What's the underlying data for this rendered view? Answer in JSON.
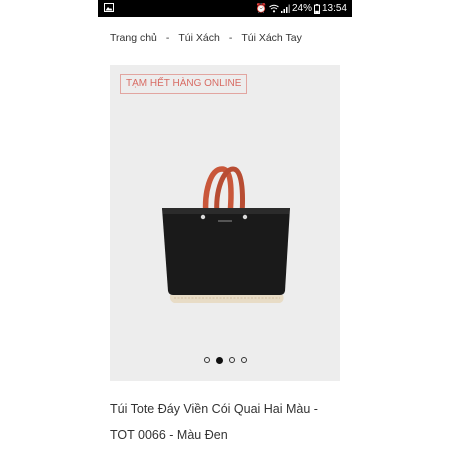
{
  "status_bar": {
    "battery_percent": "24%",
    "time": "13:54",
    "left_icon": "image-icon",
    "right_icons": [
      "alarm-icon",
      "wifi-icon",
      "signal-icon",
      "battery-icon"
    ]
  },
  "breadcrumb": {
    "items": [
      "Trang chủ",
      "Túi Xách",
      "Túi Xách Tay"
    ],
    "separator": "-"
  },
  "product": {
    "badge": "TẠM HẾT HÀNG ONLINE",
    "title_line1": "Túi Tote Đáy Viền Cói Quai Hai Màu -",
    "title_line2": "TOT 0066 - Màu Đen",
    "image_count": 4,
    "active_image_index": 1
  },
  "colors": {
    "badge_text": "#d86b63",
    "badge_border": "#e2a5a0",
    "gallery_bg": "#ededed",
    "bag_body": "#1a1a1a",
    "bag_handle": "#c9573a",
    "bag_base": "#e8dcc6"
  }
}
